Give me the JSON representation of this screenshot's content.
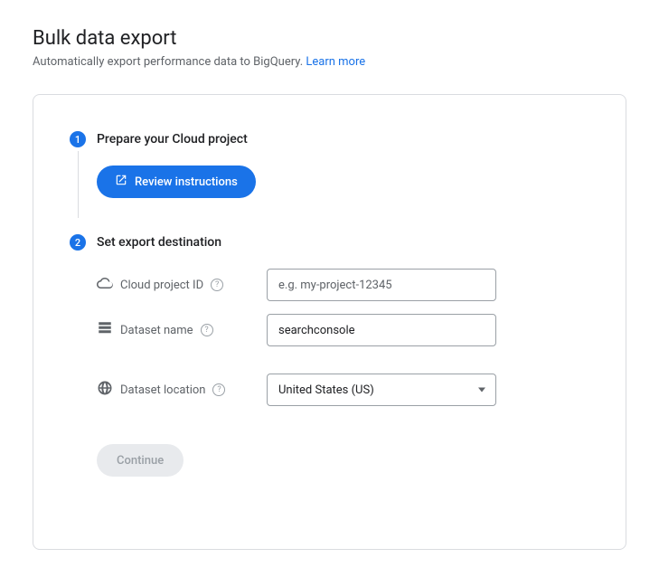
{
  "header": {
    "title": "Bulk data export",
    "subtitle": "Automatically export performance data to BigQuery.",
    "learn_more": "Learn more"
  },
  "steps": {
    "s1": {
      "num": "1",
      "title": "Prepare your Cloud project",
      "review_btn": "Review instructions"
    },
    "s2": {
      "num": "2",
      "title": "Set export destination",
      "project_id_label": "Cloud project ID",
      "project_id_placeholder": "e.g. my-project-12345",
      "project_id_value": "",
      "dataset_name_label": "Dataset name",
      "dataset_name_value": "searchconsole",
      "dataset_location_label": "Dataset location",
      "dataset_location_value": "United States (US)",
      "continue_btn": "Continue"
    }
  }
}
